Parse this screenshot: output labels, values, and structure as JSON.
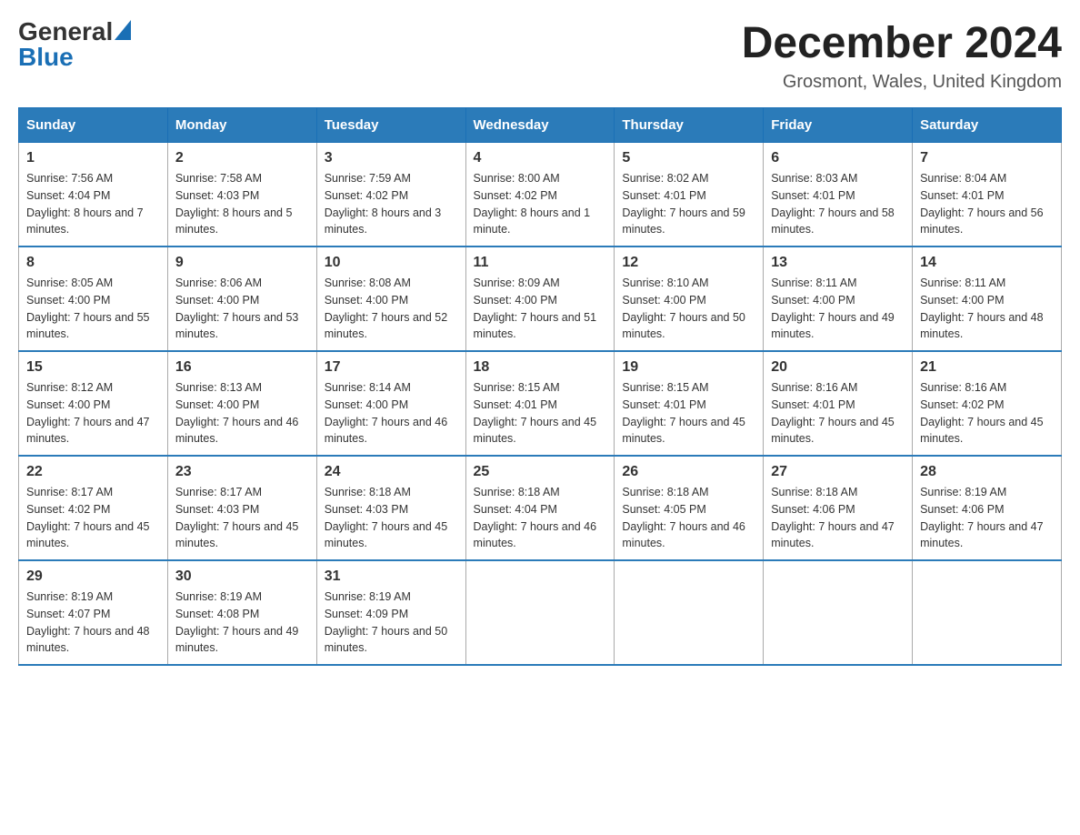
{
  "logo": {
    "general": "General",
    "blue": "Blue",
    "triangle": "▶"
  },
  "header": {
    "title": "December 2024",
    "location": "Grosmont, Wales, United Kingdom"
  },
  "days_of_week": [
    "Sunday",
    "Monday",
    "Tuesday",
    "Wednesday",
    "Thursday",
    "Friday",
    "Saturday"
  ],
  "weeks": [
    [
      {
        "day": "1",
        "sunrise": "Sunrise: 7:56 AM",
        "sunset": "Sunset: 4:04 PM",
        "daylight": "Daylight: 8 hours and 7 minutes."
      },
      {
        "day": "2",
        "sunrise": "Sunrise: 7:58 AM",
        "sunset": "Sunset: 4:03 PM",
        "daylight": "Daylight: 8 hours and 5 minutes."
      },
      {
        "day": "3",
        "sunrise": "Sunrise: 7:59 AM",
        "sunset": "Sunset: 4:02 PM",
        "daylight": "Daylight: 8 hours and 3 minutes."
      },
      {
        "day": "4",
        "sunrise": "Sunrise: 8:00 AM",
        "sunset": "Sunset: 4:02 PM",
        "daylight": "Daylight: 8 hours and 1 minute."
      },
      {
        "day": "5",
        "sunrise": "Sunrise: 8:02 AM",
        "sunset": "Sunset: 4:01 PM",
        "daylight": "Daylight: 7 hours and 59 minutes."
      },
      {
        "day": "6",
        "sunrise": "Sunrise: 8:03 AM",
        "sunset": "Sunset: 4:01 PM",
        "daylight": "Daylight: 7 hours and 58 minutes."
      },
      {
        "day": "7",
        "sunrise": "Sunrise: 8:04 AM",
        "sunset": "Sunset: 4:01 PM",
        "daylight": "Daylight: 7 hours and 56 minutes."
      }
    ],
    [
      {
        "day": "8",
        "sunrise": "Sunrise: 8:05 AM",
        "sunset": "Sunset: 4:00 PM",
        "daylight": "Daylight: 7 hours and 55 minutes."
      },
      {
        "day": "9",
        "sunrise": "Sunrise: 8:06 AM",
        "sunset": "Sunset: 4:00 PM",
        "daylight": "Daylight: 7 hours and 53 minutes."
      },
      {
        "day": "10",
        "sunrise": "Sunrise: 8:08 AM",
        "sunset": "Sunset: 4:00 PM",
        "daylight": "Daylight: 7 hours and 52 minutes."
      },
      {
        "day": "11",
        "sunrise": "Sunrise: 8:09 AM",
        "sunset": "Sunset: 4:00 PM",
        "daylight": "Daylight: 7 hours and 51 minutes."
      },
      {
        "day": "12",
        "sunrise": "Sunrise: 8:10 AM",
        "sunset": "Sunset: 4:00 PM",
        "daylight": "Daylight: 7 hours and 50 minutes."
      },
      {
        "day": "13",
        "sunrise": "Sunrise: 8:11 AM",
        "sunset": "Sunset: 4:00 PM",
        "daylight": "Daylight: 7 hours and 49 minutes."
      },
      {
        "day": "14",
        "sunrise": "Sunrise: 8:11 AM",
        "sunset": "Sunset: 4:00 PM",
        "daylight": "Daylight: 7 hours and 48 minutes."
      }
    ],
    [
      {
        "day": "15",
        "sunrise": "Sunrise: 8:12 AM",
        "sunset": "Sunset: 4:00 PM",
        "daylight": "Daylight: 7 hours and 47 minutes."
      },
      {
        "day": "16",
        "sunrise": "Sunrise: 8:13 AM",
        "sunset": "Sunset: 4:00 PM",
        "daylight": "Daylight: 7 hours and 46 minutes."
      },
      {
        "day": "17",
        "sunrise": "Sunrise: 8:14 AM",
        "sunset": "Sunset: 4:00 PM",
        "daylight": "Daylight: 7 hours and 46 minutes."
      },
      {
        "day": "18",
        "sunrise": "Sunrise: 8:15 AM",
        "sunset": "Sunset: 4:01 PM",
        "daylight": "Daylight: 7 hours and 45 minutes."
      },
      {
        "day": "19",
        "sunrise": "Sunrise: 8:15 AM",
        "sunset": "Sunset: 4:01 PM",
        "daylight": "Daylight: 7 hours and 45 minutes."
      },
      {
        "day": "20",
        "sunrise": "Sunrise: 8:16 AM",
        "sunset": "Sunset: 4:01 PM",
        "daylight": "Daylight: 7 hours and 45 minutes."
      },
      {
        "day": "21",
        "sunrise": "Sunrise: 8:16 AM",
        "sunset": "Sunset: 4:02 PM",
        "daylight": "Daylight: 7 hours and 45 minutes."
      }
    ],
    [
      {
        "day": "22",
        "sunrise": "Sunrise: 8:17 AM",
        "sunset": "Sunset: 4:02 PM",
        "daylight": "Daylight: 7 hours and 45 minutes."
      },
      {
        "day": "23",
        "sunrise": "Sunrise: 8:17 AM",
        "sunset": "Sunset: 4:03 PM",
        "daylight": "Daylight: 7 hours and 45 minutes."
      },
      {
        "day": "24",
        "sunrise": "Sunrise: 8:18 AM",
        "sunset": "Sunset: 4:03 PM",
        "daylight": "Daylight: 7 hours and 45 minutes."
      },
      {
        "day": "25",
        "sunrise": "Sunrise: 8:18 AM",
        "sunset": "Sunset: 4:04 PM",
        "daylight": "Daylight: 7 hours and 46 minutes."
      },
      {
        "day": "26",
        "sunrise": "Sunrise: 8:18 AM",
        "sunset": "Sunset: 4:05 PM",
        "daylight": "Daylight: 7 hours and 46 minutes."
      },
      {
        "day": "27",
        "sunrise": "Sunrise: 8:18 AM",
        "sunset": "Sunset: 4:06 PM",
        "daylight": "Daylight: 7 hours and 47 minutes."
      },
      {
        "day": "28",
        "sunrise": "Sunrise: 8:19 AM",
        "sunset": "Sunset: 4:06 PM",
        "daylight": "Daylight: 7 hours and 47 minutes."
      }
    ],
    [
      {
        "day": "29",
        "sunrise": "Sunrise: 8:19 AM",
        "sunset": "Sunset: 4:07 PM",
        "daylight": "Daylight: 7 hours and 48 minutes."
      },
      {
        "day": "30",
        "sunrise": "Sunrise: 8:19 AM",
        "sunset": "Sunset: 4:08 PM",
        "daylight": "Daylight: 7 hours and 49 minutes."
      },
      {
        "day": "31",
        "sunrise": "Sunrise: 8:19 AM",
        "sunset": "Sunset: 4:09 PM",
        "daylight": "Daylight: 7 hours and 50 minutes."
      },
      null,
      null,
      null,
      null
    ]
  ]
}
